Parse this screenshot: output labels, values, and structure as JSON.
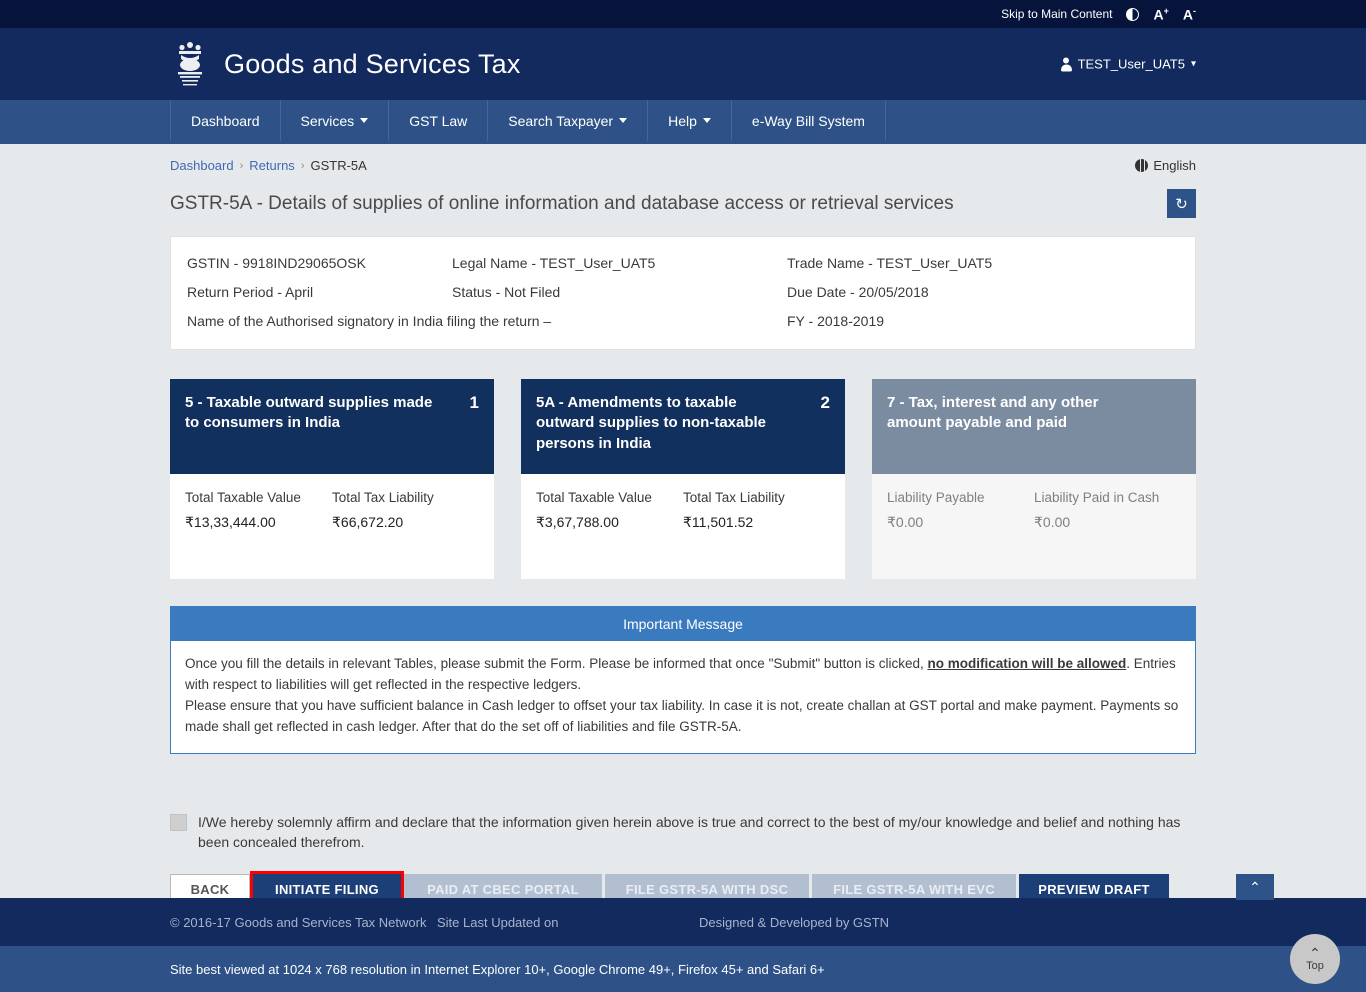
{
  "topbar": {
    "skip_link": "Skip to Main Content",
    "contrast_icon": "contrast-icon",
    "font_increase": "A",
    "font_increase_sup": "+",
    "font_decrease": "A",
    "font_decrease_sup": "-"
  },
  "header": {
    "emblem_icon": "india-emblem-icon",
    "brand": "Goods and Services Tax",
    "user": "TEST_User_UAT5",
    "user_icon": "user-icon",
    "caret_icon": "chevron-down-icon"
  },
  "nav": {
    "items": [
      {
        "label": "Dashboard",
        "has_caret": false
      },
      {
        "label": "Services",
        "has_caret": true
      },
      {
        "label": "GST Law",
        "has_caret": false
      },
      {
        "label": "Search Taxpayer",
        "has_caret": true
      },
      {
        "label": "Help",
        "has_caret": true
      },
      {
        "label": "e-Way Bill System",
        "has_caret": false
      }
    ]
  },
  "breadcrumb": {
    "items": [
      "Dashboard",
      "Returns",
      "GSTR-5A"
    ],
    "sep": "›"
  },
  "language": {
    "label": "English",
    "icon": "globe-icon"
  },
  "page": {
    "title": "GSTR-5A - Details of supplies of online information and database access or retrieval services",
    "refresh_icon": "↻"
  },
  "info": {
    "gstin": "GSTIN - 9918IND29065OSK",
    "legal_name": "Legal Name - TEST_User_UAT5",
    "trade_name": "Trade Name - TEST_User_UAT5",
    "return_period": "Return Period - April",
    "status": "Status - Not Filed",
    "due_date": "Due Date - 20/05/2018",
    "auth_signatory": "Name of the Authorised signatory in India filing the return –",
    "fy": "FY - 2018-2019"
  },
  "cards": [
    {
      "number": "1",
      "title": "5 - Taxable outward supplies made to consumers in India",
      "left_label": "Total Taxable Value",
      "left_value": "₹13,33,444.00",
      "right_label": "Total Tax Liability",
      "right_value": "₹66,672.20",
      "muted": false
    },
    {
      "number": "2",
      "title": "5A - Amendments to taxable outward supplies to non-taxable persons in India",
      "left_label": "Total Taxable Value",
      "left_value": "₹3,67,788.00",
      "right_label": "Total Tax Liability",
      "right_value": "₹11,501.52",
      "muted": false
    },
    {
      "number": "",
      "title": "7 - Tax, interest and any other amount payable and paid",
      "left_label": "Liability Payable",
      "left_value": "₹0.00",
      "right_label": "Liability Paid in Cash",
      "right_value": "₹0.00",
      "muted": true
    }
  ],
  "message": {
    "heading": "Important Message",
    "line1_a": "Once you fill the details in relevant Tables, please submit the Form. Please be informed that once \"Submit\" button is clicked, ",
    "line1_bold": "no modification will be allowed",
    "line1_b": ". Entries with respect to liabilities will get reflected in the respective ledgers.",
    "line2": "Please ensure that you have sufficient balance in Cash ledger to offset your tax liability. In case it is not, create challan at GST portal and make payment. Payments so made shall get reflected in cash ledger. After that do the set off of liabilities and file GSTR-5A."
  },
  "declaration": {
    "text": "I/We hereby solemnly affirm and declare that the information given herein above is true and correct to the best of my/our knowledge and belief and nothing has been concealed therefrom.",
    "checked": false
  },
  "buttons": {
    "back": "BACK",
    "initiate_filing": "INITIATE FILING",
    "paid_at_cbec": "PAID AT CBEC PORTAL",
    "file_dsc": "FILE GSTR-5A WITH DSC",
    "file_evc": "FILE GSTR-5A WITH EVC",
    "preview_draft": "PREVIEW DRAFT"
  },
  "footer": {
    "copyright": "© 2016-17 Goods and Services Tax Network",
    "last_updated": "Site Last Updated on",
    "designed": "Designed & Developed by GSTN",
    "best_viewed": "Site best viewed at 1024 x 768 resolution in Internet Explorer 10+, Google Chrome 49+, Firefox 45+ and Safari 6+"
  },
  "scroll_top": {
    "label": "Top",
    "chev": "⌃"
  },
  "colors": {
    "top_strip": "#06143c",
    "header": "#122a5e",
    "nav": "#2e5288",
    "body": "#e5e9ec",
    "card_header": "#12305e",
    "card_header_muted": "#7c8ca0",
    "message_header": "#3a7bbf",
    "primary_button": "#1d3f78",
    "focus_outline": "#fb0000",
    "disabled_button": "#b2bfd1"
  }
}
